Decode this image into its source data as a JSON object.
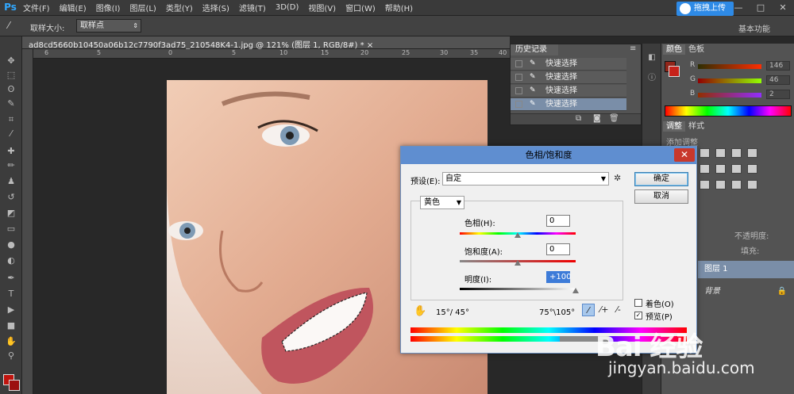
{
  "app": {
    "logo": "Ps"
  },
  "menu": [
    "文件(F)",
    "编辑(E)",
    "图像(I)",
    "图层(L)",
    "类型(Y)",
    "选择(S)",
    "滤镜(T)",
    "3D(D)",
    "视图(V)",
    "窗口(W)",
    "帮助(H)"
  ],
  "window_controls": [
    "—",
    "□",
    "✕"
  ],
  "options": {
    "sample_size_label": "取样大小:",
    "sample_size_value": "取样点",
    "upload_label": "拖拽上传",
    "workspace": "基本功能"
  },
  "document": {
    "tab_title": "ad8cd5660b10450a06b12c7790f3ad75_210548K4-1.jpg @ 121% (图层 1, RGB/8#) * ×"
  },
  "rulers": {
    "top": [
      "6",
      "5",
      "0",
      "5",
      "10",
      "15",
      "20",
      "25",
      "30",
      "35",
      "40"
    ]
  },
  "history": {
    "title": "历史记录",
    "items": [
      {
        "label": "快速选择",
        "selected": false
      },
      {
        "label": "快速选择",
        "selected": false
      },
      {
        "label": "快速选择",
        "selected": false
      },
      {
        "label": "快速选择",
        "selected": true
      }
    ]
  },
  "color_panel": {
    "tabs": [
      "颜色",
      "色板"
    ],
    "channels": [
      {
        "name": "R",
        "value": "146"
      },
      {
        "name": "G",
        "value": "46"
      },
      {
        "name": "B",
        "value": "2"
      }
    ]
  },
  "adjustments": {
    "tabs": [
      "调整",
      "样式"
    ],
    "add_label": "添加调整"
  },
  "layers": {
    "opacity_label": "不透明度:",
    "fill_label": "填充:",
    "layer1": "图层 1",
    "background": "背景"
  },
  "dialog": {
    "title": "色相/饱和度",
    "close": "✕",
    "preset_label": "预设(E):",
    "preset_value": "自定",
    "ok": "确定",
    "cancel": "取消",
    "channel": "黄色",
    "hue_label": "色相(H):",
    "hue_value": "0",
    "saturation_label": "饱和度(A):",
    "saturation_value": "0",
    "lightness_label": "明度(I):",
    "lightness_value": "+100",
    "range_left": "15°/ 45°",
    "range_right": "75°\\105°",
    "colorize_label": "着色(O)",
    "preview_label": "预览(P)",
    "colorize_checked": false,
    "preview_checked": true
  },
  "watermark": {
    "logo": "Bai 经验",
    "url": "jingyan.baidu.com"
  },
  "colors": {
    "accent": "#5f8ed0",
    "selection": "#7a8ea8",
    "foreground": "#c0140e"
  }
}
